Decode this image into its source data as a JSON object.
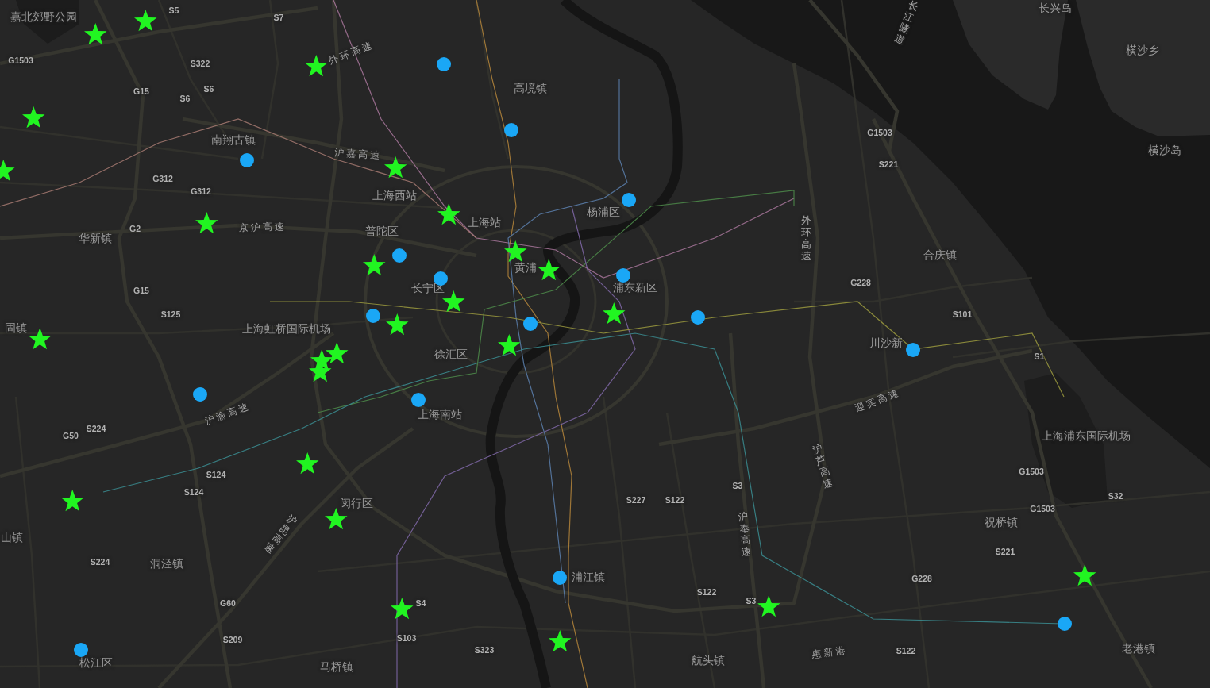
{
  "map": {
    "labels": [
      {
        "text": "嘉北郊野公园",
        "kind": "place"
      },
      {
        "text": "S5",
        "kind": "road"
      },
      {
        "text": "S7",
        "kind": "road"
      },
      {
        "text": "长江隧道",
        "kind": "vertical"
      },
      {
        "text": "长兴岛",
        "kind": "place"
      },
      {
        "text": "G1503",
        "kind": "road"
      },
      {
        "text": "S322",
        "kind": "road"
      },
      {
        "text": "外环高速",
        "kind": "highway"
      },
      {
        "text": "横沙乡",
        "kind": "place"
      },
      {
        "text": "G15",
        "kind": "road"
      },
      {
        "text": "S6",
        "kind": "road"
      },
      {
        "text": "S6",
        "kind": "road"
      },
      {
        "text": "高境镇",
        "kind": "place"
      },
      {
        "text": "南翔古镇",
        "kind": "place"
      },
      {
        "text": "G1503",
        "kind": "road"
      },
      {
        "text": "沪嘉高速",
        "kind": "highway"
      },
      {
        "text": "横沙岛",
        "kind": "place"
      },
      {
        "text": "S221",
        "kind": "road"
      },
      {
        "text": "G312",
        "kind": "road"
      },
      {
        "text": "G312",
        "kind": "road"
      },
      {
        "text": "上海西站",
        "kind": "place"
      },
      {
        "text": "杨浦区",
        "kind": "place"
      },
      {
        "text": "华新镇",
        "kind": "place"
      },
      {
        "text": "G2",
        "kind": "road"
      },
      {
        "text": "京沪高速",
        "kind": "highway"
      },
      {
        "text": "普陀区",
        "kind": "place"
      },
      {
        "text": "上海站",
        "kind": "place"
      },
      {
        "text": "外环高速",
        "kind": "vertical"
      },
      {
        "text": "合庆镇",
        "kind": "place"
      },
      {
        "text": "黄浦",
        "kind": "place"
      },
      {
        "text": "G15",
        "kind": "road"
      },
      {
        "text": "长宁区",
        "kind": "place"
      },
      {
        "text": "浦东新区",
        "kind": "place"
      },
      {
        "text": "G228",
        "kind": "road"
      },
      {
        "text": "S125",
        "kind": "road"
      },
      {
        "text": "S101",
        "kind": "road"
      },
      {
        "text": "固镇",
        "kind": "place"
      },
      {
        "text": "上海虹桥国际机场",
        "kind": "place"
      },
      {
        "text": "川沙新",
        "kind": "place"
      },
      {
        "text": "徐汇区",
        "kind": "place"
      },
      {
        "text": "S1",
        "kind": "road"
      },
      {
        "text": "沪渝高速",
        "kind": "highway"
      },
      {
        "text": "上海南站",
        "kind": "place"
      },
      {
        "text": "迎宾高速",
        "kind": "highway"
      },
      {
        "text": "G50",
        "kind": "road"
      },
      {
        "text": "S224",
        "kind": "road"
      },
      {
        "text": "上海浦东国际机场",
        "kind": "place"
      },
      {
        "text": "S124",
        "kind": "road"
      },
      {
        "text": "沪芦高速",
        "kind": "vertical"
      },
      {
        "text": "G1503",
        "kind": "road"
      },
      {
        "text": "S124",
        "kind": "road"
      },
      {
        "text": "S3",
        "kind": "road"
      },
      {
        "text": "S32",
        "kind": "road"
      },
      {
        "text": "闵行区",
        "kind": "place"
      },
      {
        "text": "S227",
        "kind": "road"
      },
      {
        "text": "S122",
        "kind": "road"
      },
      {
        "text": "G1503",
        "kind": "road"
      },
      {
        "text": "山镇",
        "kind": "place"
      },
      {
        "text": "沪昆高速",
        "kind": "vertical"
      },
      {
        "text": "沪奉高速",
        "kind": "vertical"
      },
      {
        "text": "祝桥镇",
        "kind": "place"
      },
      {
        "text": "S221",
        "kind": "road"
      },
      {
        "text": "S224",
        "kind": "road"
      },
      {
        "text": "洞泾镇",
        "kind": "place"
      },
      {
        "text": "浦江镇",
        "kind": "place"
      },
      {
        "text": "G228",
        "kind": "road"
      },
      {
        "text": "S122",
        "kind": "road"
      },
      {
        "text": "G60",
        "kind": "road"
      },
      {
        "text": "S4",
        "kind": "road"
      },
      {
        "text": "S3",
        "kind": "road"
      },
      {
        "text": "S209",
        "kind": "road"
      },
      {
        "text": "S103",
        "kind": "road"
      },
      {
        "text": "S323",
        "kind": "road"
      },
      {
        "text": "惠新港",
        "kind": "highway"
      },
      {
        "text": "S122",
        "kind": "road"
      },
      {
        "text": "老港镇",
        "kind": "place"
      },
      {
        "text": "松江区",
        "kind": "place"
      },
      {
        "text": "马桥镇",
        "kind": "place"
      },
      {
        "text": "航头镇",
        "kind": "place"
      }
    ],
    "markers": [
      {
        "kind": "star"
      },
      {
        "kind": "star"
      },
      {
        "kind": "dot"
      },
      {
        "kind": "star"
      },
      {
        "kind": "star"
      },
      {
        "kind": "dot"
      },
      {
        "kind": "dot"
      },
      {
        "kind": "star"
      },
      {
        "kind": "star"
      },
      {
        "kind": "dot"
      },
      {
        "kind": "star"
      },
      {
        "kind": "star"
      },
      {
        "kind": "dot"
      },
      {
        "kind": "star"
      },
      {
        "kind": "star"
      },
      {
        "kind": "star"
      },
      {
        "kind": "dot"
      },
      {
        "kind": "dot"
      },
      {
        "kind": "star"
      },
      {
        "kind": "star"
      },
      {
        "kind": "dot"
      },
      {
        "kind": "dot"
      },
      {
        "kind": "dot"
      },
      {
        "kind": "star"
      },
      {
        "kind": "star"
      },
      {
        "kind": "star"
      },
      {
        "kind": "dot"
      },
      {
        "kind": "star"
      },
      {
        "kind": "star"
      },
      {
        "kind": "star"
      },
      {
        "kind": "dot"
      },
      {
        "kind": "dot"
      },
      {
        "kind": "star"
      },
      {
        "kind": "star"
      },
      {
        "kind": "star"
      },
      {
        "kind": "star"
      },
      {
        "kind": "dot"
      },
      {
        "kind": "star"
      },
      {
        "kind": "star"
      },
      {
        "kind": "dot"
      },
      {
        "kind": "star"
      },
      {
        "kind": "dot"
      }
    ]
  }
}
